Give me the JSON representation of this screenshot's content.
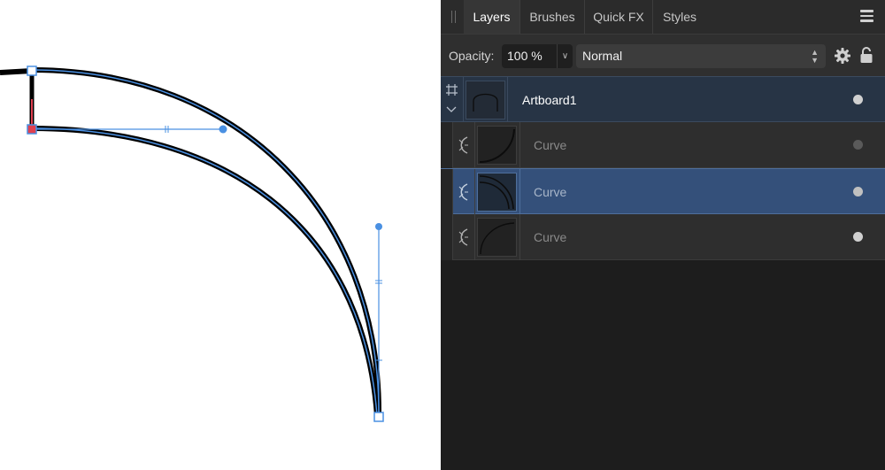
{
  "window": {
    "panel_title": "Layers"
  },
  "tabs": [
    {
      "label": "Layers",
      "active": true
    },
    {
      "label": "Brushes",
      "active": false
    },
    {
      "label": "Quick FX",
      "active": false
    },
    {
      "label": "Styles",
      "active": false
    }
  ],
  "options": {
    "opacity_label": "Opacity:",
    "opacity_value": "100 %",
    "blend_mode": "Normal"
  },
  "layers": [
    {
      "name": "Artboard1",
      "type": "artboard",
      "icon": "artboard-frame-icon",
      "visible": true,
      "selected": false
    },
    {
      "name": "Curve",
      "type": "curve",
      "icon": "curve-icon",
      "visible": false,
      "selected": false
    },
    {
      "name": "Curve",
      "type": "curve",
      "icon": "curve-icon",
      "visible": true,
      "selected": true
    },
    {
      "name": "Curve",
      "type": "curve",
      "icon": "curve-icon",
      "visible": true,
      "selected": false
    }
  ],
  "colors": {
    "selection_blue": "#4a90e2",
    "selected_row": "#34507a",
    "artboard_row": "#273445",
    "node_red": "#e04050",
    "stroke_black": "#000000"
  }
}
